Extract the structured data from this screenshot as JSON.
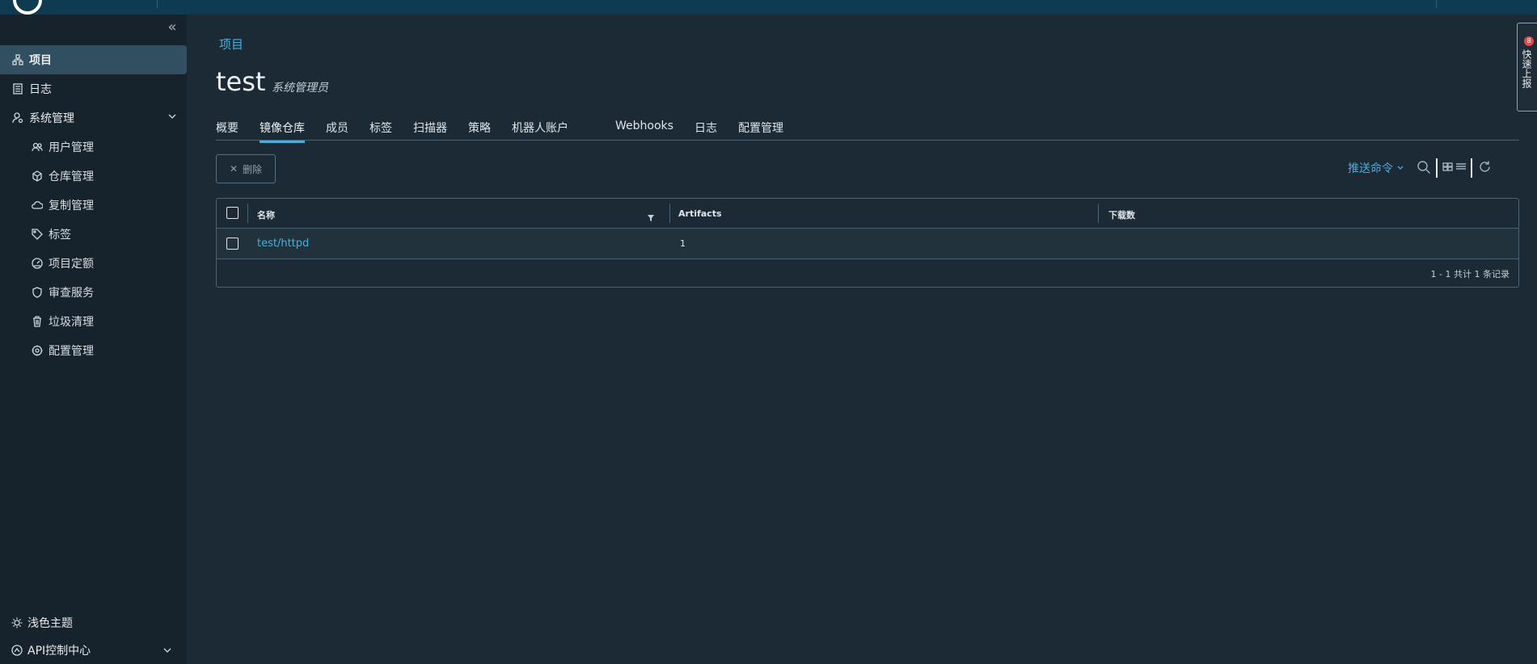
{
  "sidebar": {
    "items": [
      {
        "label": "项目",
        "icon": "project-icon"
      },
      {
        "label": "日志",
        "icon": "log-icon"
      },
      {
        "label": "系统管理",
        "icon": "admin-icon"
      },
      {
        "label": "用户管理",
        "icon": "users-icon"
      },
      {
        "label": "仓库管理",
        "icon": "registry-icon"
      },
      {
        "label": "复制管理",
        "icon": "replication-icon"
      },
      {
        "label": "标签",
        "icon": "tag-icon"
      },
      {
        "label": "项目定额",
        "icon": "quota-icon"
      },
      {
        "label": "审查服务",
        "icon": "shield-icon"
      },
      {
        "label": "垃圾清理",
        "icon": "trash-icon"
      },
      {
        "label": "配置管理",
        "icon": "gear-icon"
      }
    ],
    "bottom": [
      {
        "label": "浅色主题",
        "icon": "sun-icon"
      },
      {
        "label": "API控制中心",
        "icon": "api-icon"
      }
    ]
  },
  "main": {
    "breadcrumb": "项目",
    "title": "test",
    "role": "系统管理员",
    "tabs": [
      "概要",
      "镜像仓库",
      "成员",
      "标签",
      "扫描器",
      "策略",
      "机器人账户",
      "Webhooks",
      "日志",
      "配置管理"
    ],
    "active_tab": "镜像仓库",
    "delete_label": "删除",
    "push_command_label": "推送命令"
  },
  "grid": {
    "columns": [
      "名称",
      "Artifacts",
      "下载数"
    ],
    "rows": [
      {
        "name": "test/httpd",
        "artifacts": "1",
        "downloads": ""
      }
    ],
    "footer": "1 - 1 共计 1 条记录"
  },
  "float_panel": {
    "badge": "8",
    "text": "快速上报"
  },
  "colors": {
    "accent": "#49aedb",
    "background": "#1c2a35",
    "sidebar": "#17232c",
    "active_item": "#324f62"
  }
}
